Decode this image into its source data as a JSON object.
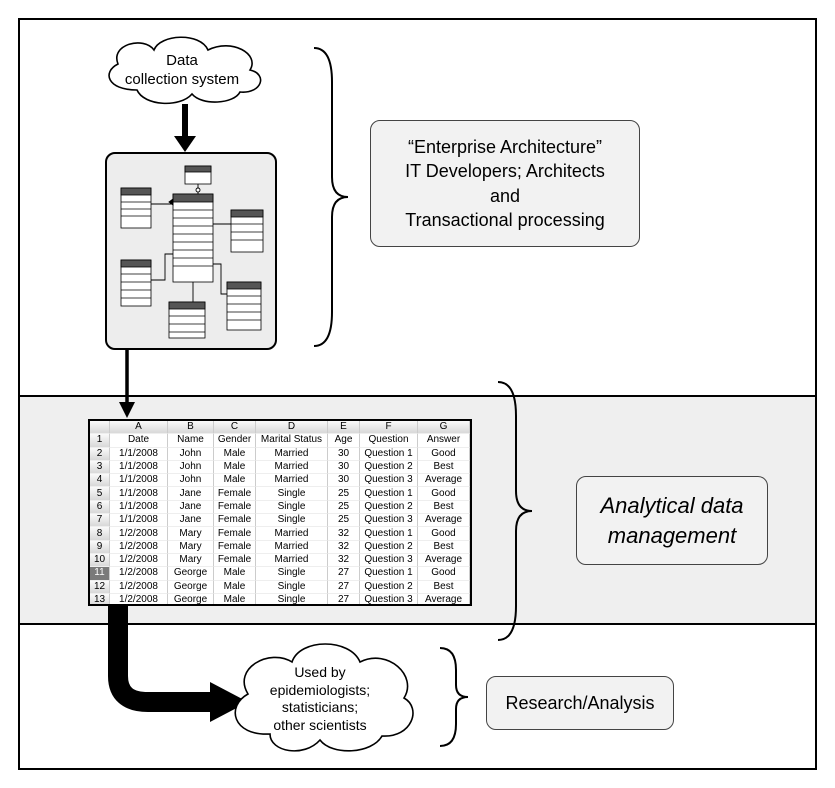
{
  "clouds": {
    "data_collection": {
      "line1": "Data",
      "line2": "collection system"
    },
    "used_by": {
      "line1": "Used by",
      "line2": "epidemiologists;",
      "line3": "statisticians;",
      "line4": "other scientists"
    }
  },
  "labels": {
    "enterprise": {
      "line1": "“Enterprise Architecture”",
      "line2": "IT Developers; Architects and",
      "line3": "Transactional processing"
    },
    "analytical": {
      "line1": "Analytical data",
      "line2": "management"
    },
    "research": "Research/Analysis"
  },
  "spreadsheet": {
    "col_letters": [
      "A",
      "B",
      "C",
      "D",
      "E",
      "F",
      "G"
    ],
    "field_headers": [
      "Date",
      "Name",
      "Gender",
      "Marital Status",
      "Age",
      "Question",
      "Answer"
    ],
    "rows": [
      {
        "n": 2,
        "date": "1/1/2008",
        "name": "John",
        "gender": "Male",
        "marital": "Married",
        "age": 30,
        "q": "Question 1",
        "a": "Good"
      },
      {
        "n": 3,
        "date": "1/1/2008",
        "name": "John",
        "gender": "Male",
        "marital": "Married",
        "age": 30,
        "q": "Question 2",
        "a": "Best"
      },
      {
        "n": 4,
        "date": "1/1/2008",
        "name": "John",
        "gender": "Male",
        "marital": "Married",
        "age": 30,
        "q": "Question 3",
        "a": "Average"
      },
      {
        "n": 5,
        "date": "1/1/2008",
        "name": "Jane",
        "gender": "Female",
        "marital": "Single",
        "age": 25,
        "q": "Question 1",
        "a": "Good"
      },
      {
        "n": 6,
        "date": "1/1/2008",
        "name": "Jane",
        "gender": "Female",
        "marital": "Single",
        "age": 25,
        "q": "Question 2",
        "a": "Best"
      },
      {
        "n": 7,
        "date": "1/1/2008",
        "name": "Jane",
        "gender": "Female",
        "marital": "Single",
        "age": 25,
        "q": "Question 3",
        "a": "Average"
      },
      {
        "n": 8,
        "date": "1/2/2008",
        "name": "Mary",
        "gender": "Female",
        "marital": "Married",
        "age": 32,
        "q": "Question 1",
        "a": "Good"
      },
      {
        "n": 9,
        "date": "1/2/2008",
        "name": "Mary",
        "gender": "Female",
        "marital": "Married",
        "age": 32,
        "q": "Question 2",
        "a": "Best"
      },
      {
        "n": 10,
        "date": "1/2/2008",
        "name": "Mary",
        "gender": "Female",
        "marital": "Married",
        "age": 32,
        "q": "Question 3",
        "a": "Average"
      },
      {
        "n": 11,
        "date": "1/2/2008",
        "name": "George",
        "gender": "Male",
        "marital": "Single",
        "age": 27,
        "q": "Question 1",
        "a": "Good",
        "sel": true
      },
      {
        "n": 12,
        "date": "1/2/2008",
        "name": "George",
        "gender": "Male",
        "marital": "Single",
        "age": 27,
        "q": "Question 2",
        "a": "Best"
      },
      {
        "n": 13,
        "date": "1/2/2008",
        "name": "George",
        "gender": "Male",
        "marital": "Single",
        "age": 27,
        "q": "Question 3",
        "a": "Average"
      }
    ]
  }
}
